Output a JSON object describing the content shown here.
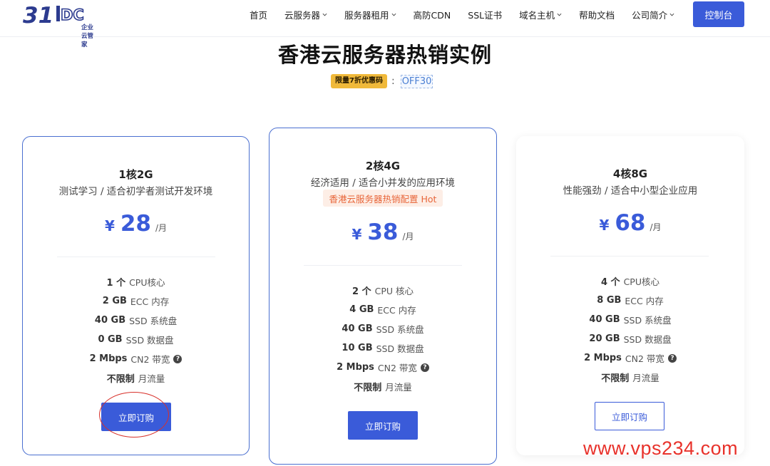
{
  "header": {
    "logo_text": "31IDC",
    "logo_sub": "企业云管家",
    "nav": [
      {
        "label": "首页",
        "dropdown": false
      },
      {
        "label": "云服务器",
        "dropdown": true
      },
      {
        "label": "服务器租用",
        "dropdown": true
      },
      {
        "label": "高防CDN",
        "dropdown": false
      },
      {
        "label": "SSL证书",
        "dropdown": false
      },
      {
        "label": "域名主机",
        "dropdown": true
      },
      {
        "label": "帮助文档",
        "dropdown": false
      },
      {
        "label": "公司简介",
        "dropdown": true
      }
    ],
    "console_label": "控制台"
  },
  "main": {
    "title": "香港云服务器热销实例",
    "promo_badge": "限量7折优惠码",
    "promo_colon": ":",
    "promo_code": "OFF30"
  },
  "plans": [
    {
      "title": "1核2G",
      "desc": "测试学习 / 适合初学者测试开发环境",
      "currency": "¥",
      "price": "28",
      "unit": "/月",
      "specs": [
        {
          "value": "1 个",
          "label": "CPU核心"
        },
        {
          "value": "2 GB",
          "label": "ECC 内存"
        },
        {
          "value": "40 GB",
          "label": "SSD 系统盘"
        },
        {
          "value": "0 GB",
          "label": "SSD 数据盘"
        },
        {
          "value": "2 Mbps",
          "label": "CN2 带宽"
        },
        {
          "value": "不限制",
          "label": "月流量"
        }
      ],
      "button": "立即订购"
    },
    {
      "title": "2核4G",
      "desc": "经济适用 / 适合小并发的应用环境",
      "hot": "香港云服务器热销配置 Hot",
      "currency": "¥",
      "price": "38",
      "unit": "/月",
      "specs": [
        {
          "value": "2 个",
          "label": "CPU 核心"
        },
        {
          "value": "4 GB",
          "label": "ECC 内存"
        },
        {
          "value": "40 GB",
          "label": "SSD 系统盘"
        },
        {
          "value": "10 GB",
          "label": "SSD 数据盘"
        },
        {
          "value": "2 Mbps",
          "label": "CN2 带宽"
        },
        {
          "value": "不限制",
          "label": "月流量"
        }
      ],
      "button": "立即订购"
    },
    {
      "title": "4核8G",
      "desc": "性能强劲 / 适合中小型企业应用",
      "currency": "¥",
      "price": "68",
      "unit": "/月",
      "specs": [
        {
          "value": "4 个",
          "label": "CPU核心"
        },
        {
          "value": "8 GB",
          "label": "ECC 内存"
        },
        {
          "value": "40 GB",
          "label": "SSD 系统盘"
        },
        {
          "value": "20 GB",
          "label": "SSD 数据盘"
        },
        {
          "value": "2 Mbps",
          "label": "CN2 带宽"
        },
        {
          "value": "不限制",
          "label": "月流量"
        }
      ],
      "button": "立即订购"
    }
  ],
  "help_glyph": "?",
  "watermark": "www.vps234.com",
  "colors": {
    "accent": "#3a5bd9",
    "promo": "#f0b93a",
    "hot": "#e8663a",
    "annotation": "#d8312b"
  }
}
